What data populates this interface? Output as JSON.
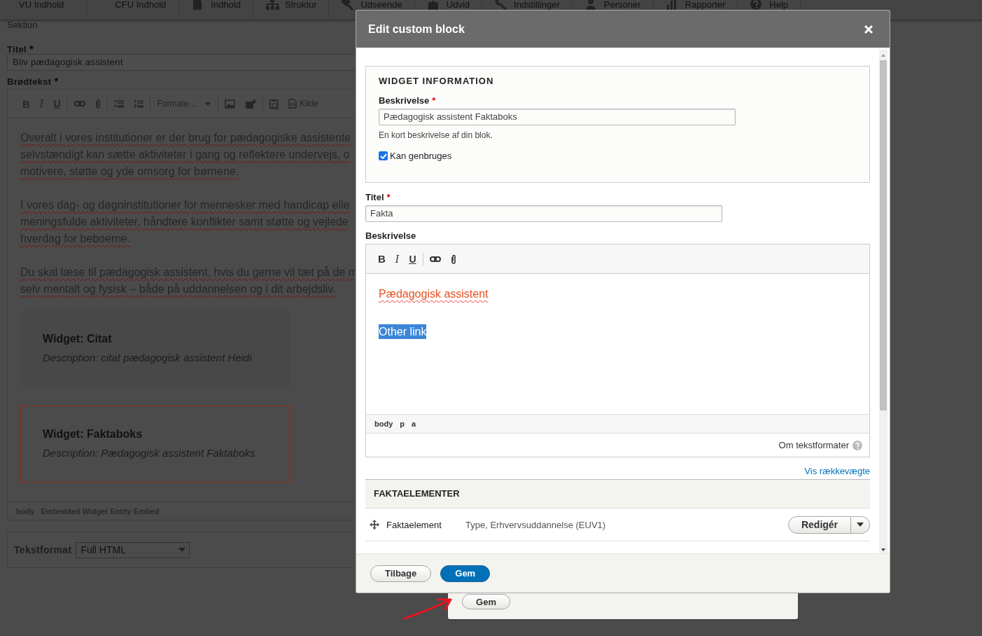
{
  "nav": [
    {
      "label": "VU Indhold"
    },
    {
      "label": "CFU Indhold"
    },
    {
      "label": "Indhold"
    },
    {
      "label": "Struktur"
    },
    {
      "label": "Udseende"
    },
    {
      "label": "Udvid"
    },
    {
      "label": "Indstillinger"
    },
    {
      "label": "Personer"
    },
    {
      "label": "Rapporter"
    },
    {
      "label": "Help"
    }
  ],
  "page": {
    "section_label": "Sektion",
    "title_field": {
      "label": "Titel",
      "required_mark": "*",
      "value": "Bliv pædagogisk assistent"
    },
    "body_label": {
      "label": "Brødtekst",
      "required_mark": "*"
    },
    "toolbar": [
      {
        "kind": "bold",
        "label": "B"
      },
      {
        "kind": "italic",
        "label": "I"
      },
      {
        "kind": "underline",
        "label": "U"
      },
      {
        "kind": "separator"
      },
      {
        "kind": "link"
      },
      {
        "kind": "attach"
      },
      {
        "kind": "separator"
      },
      {
        "kind": "bullets"
      },
      {
        "kind": "numbers"
      },
      {
        "kind": "separator"
      },
      {
        "kind": "dropdown",
        "label": "Formate…"
      },
      {
        "kind": "separator"
      },
      {
        "kind": "image"
      },
      {
        "kind": "widget"
      },
      {
        "kind": "separator"
      },
      {
        "kind": "paste"
      },
      {
        "kind": "source",
        "label": "Kilde"
      }
    ],
    "paragraphs": [
      [
        "Overalt i vores institutioner er der brug for pædagogiske assistente",
        "selvstændigt kan sætte aktiviteter i gang og reflektere undervejs, o",
        "motivere, støtte og yde omsorg for børnene."
      ],
      [
        "I vores dag- og døgninstitutioner for mennesker med handicap elle",
        "meningsfulde aktiviteter, håndtere konflikter samt støtte og vejlede",
        "hverdag for beboerne."
      ],
      [
        "Du skal læse til pædagogisk assistent, hvis du gerne vil tæt på de m",
        "selv mentalt og fysisk – både på uddannelsen og i dit arbejdsliv."
      ]
    ],
    "widgets": [
      {
        "title": "Widget: Citat",
        "description": "Description: citat pædagogisk assistent Heidi",
        "selected": false
      },
      {
        "title": "Widget: Faktaboks",
        "description": "Description: Pædagogisk assistent Faktaboks",
        "selected": true
      }
    ],
    "path": [
      "body",
      "Embedded Widget Entity Embed"
    ],
    "format": {
      "label": "Tekstformat",
      "value": "Full HTML"
    }
  },
  "behind_dialog": {
    "button": "Gem"
  },
  "dialog": {
    "title": "Edit custom block",
    "widget_info": {
      "legend": "WIDGET INFORMATION",
      "description": {
        "label": "Beskrivelse",
        "required_mark": "*",
        "value": "Pædagogisk assistent Faktaboks",
        "help": "En kort beskrivelse af din blok."
      },
      "reusable": {
        "label": "Kan genbruges",
        "checked": true
      }
    },
    "title_field": {
      "label": "Titel",
      "required_mark": "*",
      "value": "Fakta"
    },
    "description_label": "Beskrivelse",
    "editor": {
      "toolbar": [
        {
          "kind": "bold",
          "label": "B"
        },
        {
          "kind": "italic",
          "label": "I"
        },
        {
          "kind": "underline",
          "label": "U"
        },
        {
          "kind": "separator"
        },
        {
          "kind": "link"
        },
        {
          "kind": "attach"
        }
      ],
      "lines": [
        {
          "kind": "link",
          "text": "Pædagogisk assistent"
        },
        {
          "kind": "selected",
          "text": "Other link"
        }
      ],
      "path": [
        "body",
        "p",
        "a"
      ],
      "formats_link": "Om tekstformater"
    },
    "row_weights_link": "Vis rækkevægte",
    "table": {
      "header": "FAKTAELEMENTER",
      "rows": [
        {
          "name": "Faktaelement",
          "value": "Type, Erhvervsuddannelse (EUV1)",
          "button": "Redigér"
        }
      ]
    },
    "buttons": [
      {
        "label": "Tilbage",
        "kind": "secondary"
      },
      {
        "label": "Gem",
        "kind": "primary"
      }
    ]
  }
}
